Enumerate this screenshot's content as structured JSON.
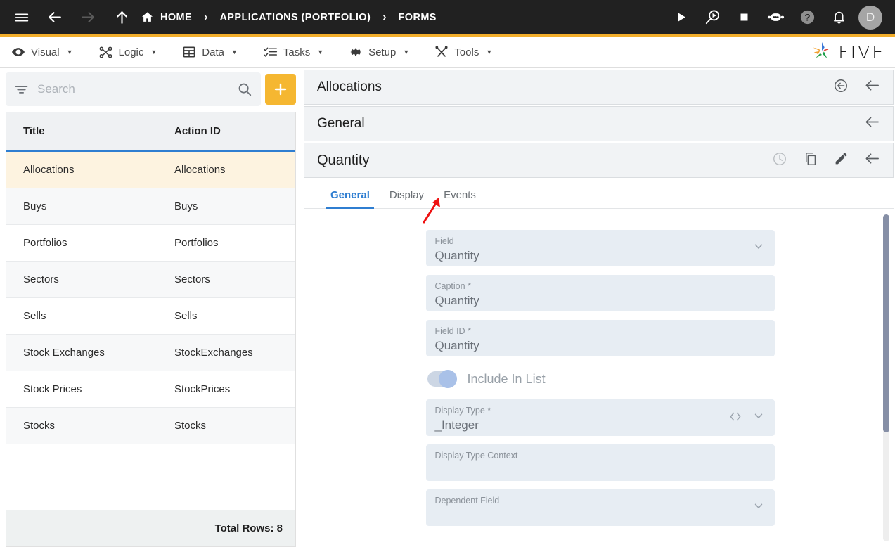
{
  "topbar": {
    "menu_icon": "hamburger-icon",
    "back_icon": "arrow-left-icon",
    "forward_icon": "arrow-right-icon",
    "up_icon": "arrow-up-icon",
    "breadcrumbs": [
      {
        "label": "HOME",
        "icon": "home-icon"
      },
      {
        "label": "APPLICATIONS (PORTFOLIO)",
        "icon": ""
      },
      {
        "label": "FORMS",
        "icon": ""
      }
    ],
    "separator": "›",
    "actions": [
      {
        "name": "run-icon"
      },
      {
        "name": "debug-search-icon"
      },
      {
        "name": "stop-icon"
      },
      {
        "name": "robot-icon"
      },
      {
        "name": "help-icon"
      },
      {
        "name": "notifications-icon"
      }
    ],
    "avatar_initial": "D"
  },
  "menubar": {
    "items": [
      {
        "label": "Visual",
        "icon": "eye-icon",
        "caret": "▼"
      },
      {
        "label": "Logic",
        "icon": "logic-nodes-icon",
        "caret": "▼"
      },
      {
        "label": "Data",
        "icon": "table-icon",
        "caret": "▼"
      },
      {
        "label": "Tasks",
        "icon": "checklist-icon",
        "caret": "▼"
      },
      {
        "label": "Setup",
        "icon": "gear-icon",
        "caret": "▼"
      },
      {
        "label": "Tools",
        "icon": "tools-icon",
        "caret": "▼"
      }
    ],
    "brand": "FIVE"
  },
  "sidebar": {
    "search": {
      "value": "",
      "placeholder": "Search",
      "filter_icon": "filter-icon",
      "search_icon": "search-icon"
    },
    "add_button": {
      "label": "+",
      "color": "#f5b731"
    },
    "table": {
      "columns": [
        "Title",
        "Action ID"
      ],
      "rows": [
        {
          "title": "Allocations",
          "action_id": "Allocations",
          "selected": true
        },
        {
          "title": "Buys",
          "action_id": "Buys",
          "selected": false
        },
        {
          "title": "Portfolios",
          "action_id": "Portfolios",
          "selected": false
        },
        {
          "title": "Sectors",
          "action_id": "Sectors",
          "selected": false
        },
        {
          "title": "Sells",
          "action_id": "Sells",
          "selected": false
        },
        {
          "title": "Stock Exchanges",
          "action_id": "StockExchanges",
          "selected": false
        },
        {
          "title": "Stock Prices",
          "action_id": "StockPrices",
          "selected": false
        },
        {
          "title": "Stocks",
          "action_id": "Stocks",
          "selected": false
        }
      ]
    },
    "footer": "Total Rows: 8"
  },
  "main": {
    "panels": [
      {
        "title": "Allocations",
        "actions": [
          {
            "name": "revert-circle-icon"
          },
          {
            "name": "back-arrow-icon"
          }
        ]
      },
      {
        "title": "General",
        "actions": [
          {
            "name": "back-arrow-icon"
          }
        ]
      },
      {
        "title": "Quantity",
        "actions": [
          {
            "name": "history-clock-icon"
          },
          {
            "name": "copy-icon"
          },
          {
            "name": "edit-pencil-icon"
          },
          {
            "name": "back-arrow-icon"
          }
        ]
      }
    ],
    "tabs": [
      {
        "label": "General",
        "active": true
      },
      {
        "label": "Display",
        "active": false
      },
      {
        "label": "Events",
        "active": false
      }
    ],
    "form": {
      "fields": [
        {
          "label": "Field",
          "value": "Quantity",
          "chevron": true,
          "code": false
        },
        {
          "label": "Caption *",
          "value": "Quantity",
          "chevron": false,
          "code": false
        },
        {
          "label": "Field ID *",
          "value": "Quantity",
          "chevron": false,
          "code": false
        }
      ],
      "toggle": {
        "label": "Include In List",
        "on": true
      },
      "fields2": [
        {
          "label": "Display Type *",
          "value": "_Integer",
          "chevron": true,
          "code": true
        },
        {
          "label": "Display Type Context",
          "value": "",
          "chevron": false,
          "code": false
        },
        {
          "label": "Dependent Field",
          "value": "",
          "chevron": true,
          "code": false
        }
      ]
    },
    "annotation": {
      "type": "red-arrow",
      "color": "#ee1111",
      "points_to": "Events"
    }
  },
  "colors": {
    "topbar_bg": "#212121",
    "accent_yellow": "#f3ae2b",
    "selected_row": "#fdf3e0",
    "tab_active": "#2f7ed1",
    "field_bg": "#e7edf3"
  }
}
